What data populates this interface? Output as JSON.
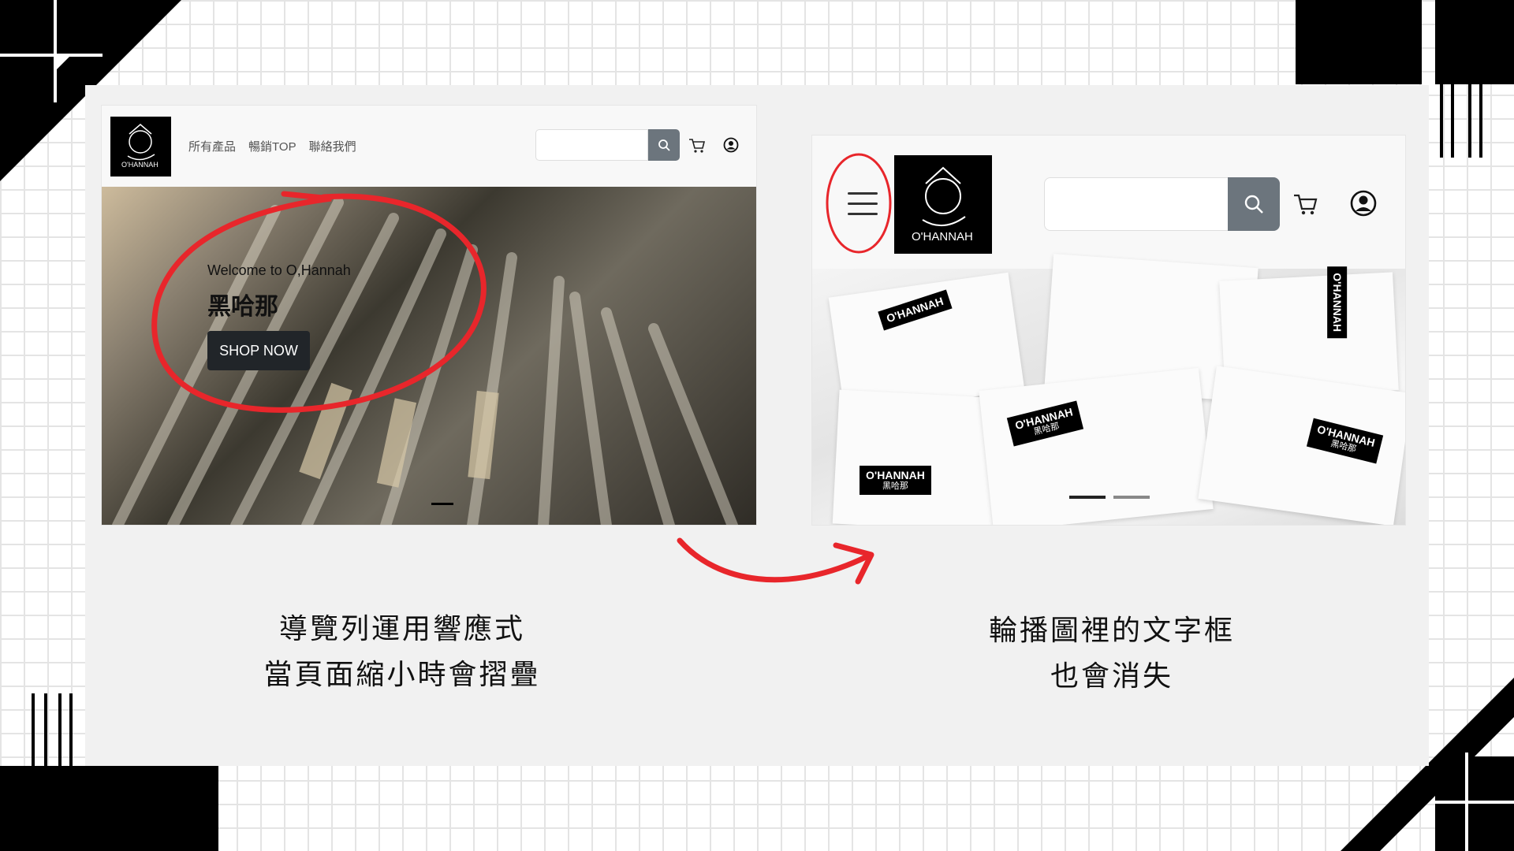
{
  "left_screenshot": {
    "nav_links": [
      "所有產品",
      "暢銷TOP",
      "聯絡我們"
    ],
    "logo_text": "O'HANNAH 黑哈那",
    "hero_welcome": "Welcome to O,Hannah",
    "hero_title": "黑哈那",
    "hero_button": "SHOP NOW",
    "icons": {
      "search": "search-icon",
      "cart": "cart-icon",
      "user": "user-circle-icon"
    }
  },
  "right_screenshot": {
    "logo_text": "O'HANNAH 黑哈那",
    "packet_brand": "O'HANNAH",
    "packet_brand_cn": "黑哈那",
    "icons": {
      "menu": "hamburger-icon",
      "search": "search-icon",
      "cart": "cart-icon",
      "user": "user-circle-icon"
    }
  },
  "captions": {
    "left_line1": "導覽列運用響應式",
    "left_line2": "當頁面縮小時會摺疊",
    "right_line1": "輪播圖裡的文字框",
    "right_line2": "也會消失"
  },
  "colors": {
    "annotation_red": "#e8262b",
    "search_button": "#6c757d",
    "dark_button": "#212529"
  }
}
